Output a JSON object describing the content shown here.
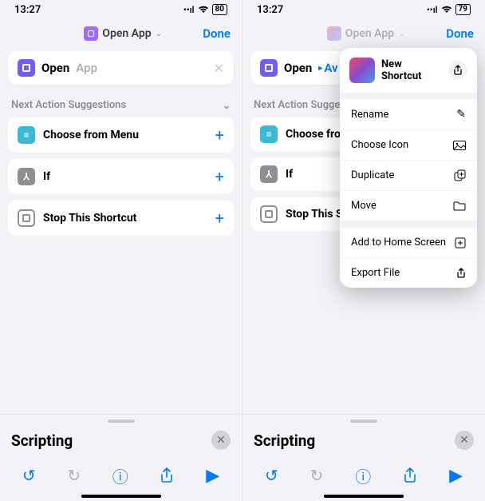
{
  "left": {
    "status": {
      "time": "13:27",
      "battery": "80"
    },
    "nav": {
      "title": "Open App",
      "done": "Done"
    },
    "action": {
      "label": "Open",
      "placeholder": "App"
    },
    "section": "Next Action Suggestions",
    "suggestions": [
      {
        "label": "Choose from Menu"
      },
      {
        "label": "If"
      },
      {
        "label": "Stop This Shortcut"
      }
    ],
    "sheet_title": "Scripting"
  },
  "right": {
    "status": {
      "time": "13:27",
      "battery": "79"
    },
    "nav": {
      "title": "Open App",
      "done": "Done"
    },
    "action": {
      "label": "Open",
      "value": "Av"
    },
    "section": "Next Action Sugge",
    "suggestions": [
      {
        "label": "Choose from"
      },
      {
        "label": "If"
      },
      {
        "label": "Stop This Sho"
      }
    ],
    "sheet_title": "Scripting",
    "popup": {
      "title": "New Shortcut",
      "items": [
        {
          "label": "Rename",
          "icon": "pencil"
        },
        {
          "label": "Choose Icon",
          "icon": "image"
        },
        {
          "label": "Duplicate",
          "icon": "duplicate"
        },
        {
          "label": "Move",
          "icon": "folder"
        }
      ],
      "items2": [
        {
          "label": "Add to Home Screen",
          "icon": "add-square"
        },
        {
          "label": "Export File",
          "icon": "export"
        }
      ]
    }
  }
}
